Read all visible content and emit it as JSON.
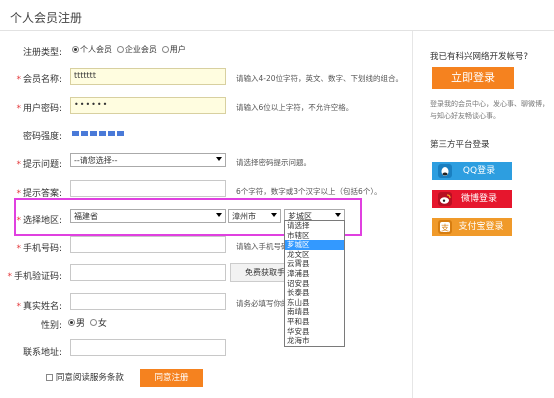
{
  "page": {
    "title": "个人会员注册"
  },
  "form": {
    "reg_type": {
      "label": "注册类型:",
      "options": [
        "个人会员",
        "企业会员",
        "用户"
      ],
      "selected": 0
    },
    "member_name": {
      "label": "会员名称:",
      "value": "ttttttt",
      "hint": "请输入4-20位字符，英文、数字、下划线的组合。"
    },
    "password": {
      "label": "用户密码:",
      "value": "••••••",
      "hint": "请输入6位以上字符，不允许空格。"
    },
    "strength": {
      "label": "密码强度:",
      "levels": 6,
      "color": "#4a7ad8"
    },
    "question": {
      "label": "提示问题:",
      "value": "--请您选择--",
      "hint": "请选择密码提示问题。"
    },
    "answer": {
      "label": "提示答案:",
      "hint": "6个字符，数字或3个汉字以上（包括6个）。"
    },
    "region": {
      "label": "选择地区:",
      "province": "福建省",
      "city": "漳州市",
      "district": "芗城区",
      "dropdown_options": [
        "请选择",
        "市辖区",
        "芗城区",
        "龙文区",
        "云霄县",
        "漳浦县",
        "诏安县",
        "长泰县",
        "东山县",
        "南靖县",
        "平和县",
        "华安县",
        "龙海市"
      ],
      "dropdown_highlighted": 2
    },
    "phone": {
      "label": "手机号码:",
      "hint": "请输入手机号码"
    },
    "verify": {
      "label": "手机验证码:",
      "button": "免费获取手"
    },
    "realname": {
      "label": "真实姓名:",
      "hint": "请务必填写你的"
    },
    "gender": {
      "label": "性别:",
      "options": [
        "男",
        "女"
      ],
      "selected": 0
    },
    "address": {
      "label": "联系地址:"
    },
    "agree": {
      "label": "同意阅读服务条款",
      "button": "同意注册"
    }
  },
  "sidebar": {
    "have_account": "我已有科兴网络开发帐号?",
    "login_button": "立即登录",
    "login_desc_1": "登录我的会员中心，发心事、聊微博，",
    "login_desc_2": "与知心好友畅谈心事。",
    "third_party_title": "第三方平台登录",
    "qq_label": "QQ登录",
    "weibo_label": "微博登录",
    "alipay_label": "支付宝登录"
  },
  "colors": {
    "accent_orange": "#f5821f",
    "qq_blue": "#2d9ee0",
    "weibo_red": "#e6162d",
    "alipay_orange": "#f09a2a",
    "required_star": "#e4393c",
    "highlight_box": "#e040e0"
  }
}
